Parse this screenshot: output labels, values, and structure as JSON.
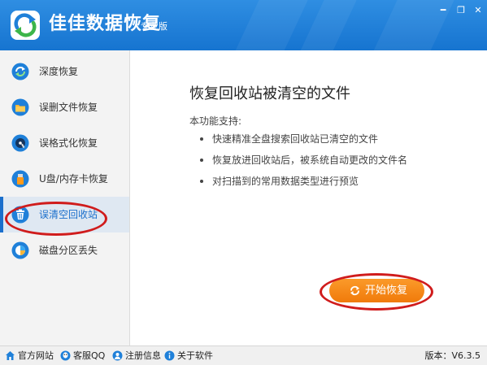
{
  "app": {
    "title": "佳佳数据恢复",
    "edition": "专业版"
  },
  "window_controls": {
    "minimize": "━",
    "restore": "❐",
    "close": "✕"
  },
  "sidebar": {
    "items": [
      {
        "label": "深度恢复",
        "icon": "deep-recovery-icon"
      },
      {
        "label": "误删文件恢复",
        "icon": "folder-icon"
      },
      {
        "label": "误格式化恢复",
        "icon": "disk-icon"
      },
      {
        "label": "U盘/内存卡恢复",
        "icon": "usb-icon"
      },
      {
        "label": "误清空回收站",
        "icon": "recycle-bin-icon",
        "active": true
      },
      {
        "label": "磁盘分区丢失",
        "icon": "partition-icon"
      }
    ]
  },
  "main": {
    "title": "恢复回收站被清空的文件",
    "support_label": "本功能支持:",
    "features": [
      "快速精准全盘搜索回收站已清空的文件",
      "恢复放进回收站后，被系统自动更改的文件名",
      "对扫描到的常用数据类型进行预览"
    ],
    "start_button": "开始恢复"
  },
  "footer": {
    "links": [
      {
        "label": "官方网站",
        "icon": "home-icon"
      },
      {
        "label": "客服QQ",
        "icon": "qq-icon"
      },
      {
        "label": "注册信息",
        "icon": "user-icon"
      },
      {
        "label": "关于软件",
        "icon": "info-icon"
      }
    ],
    "version": "版本：V6.3.5"
  },
  "colors": {
    "titlebar": "#1f80d9",
    "accent": "#1b6fcc",
    "start_button": "#f58a14",
    "highlight_ellipse": "#d01c1c"
  }
}
